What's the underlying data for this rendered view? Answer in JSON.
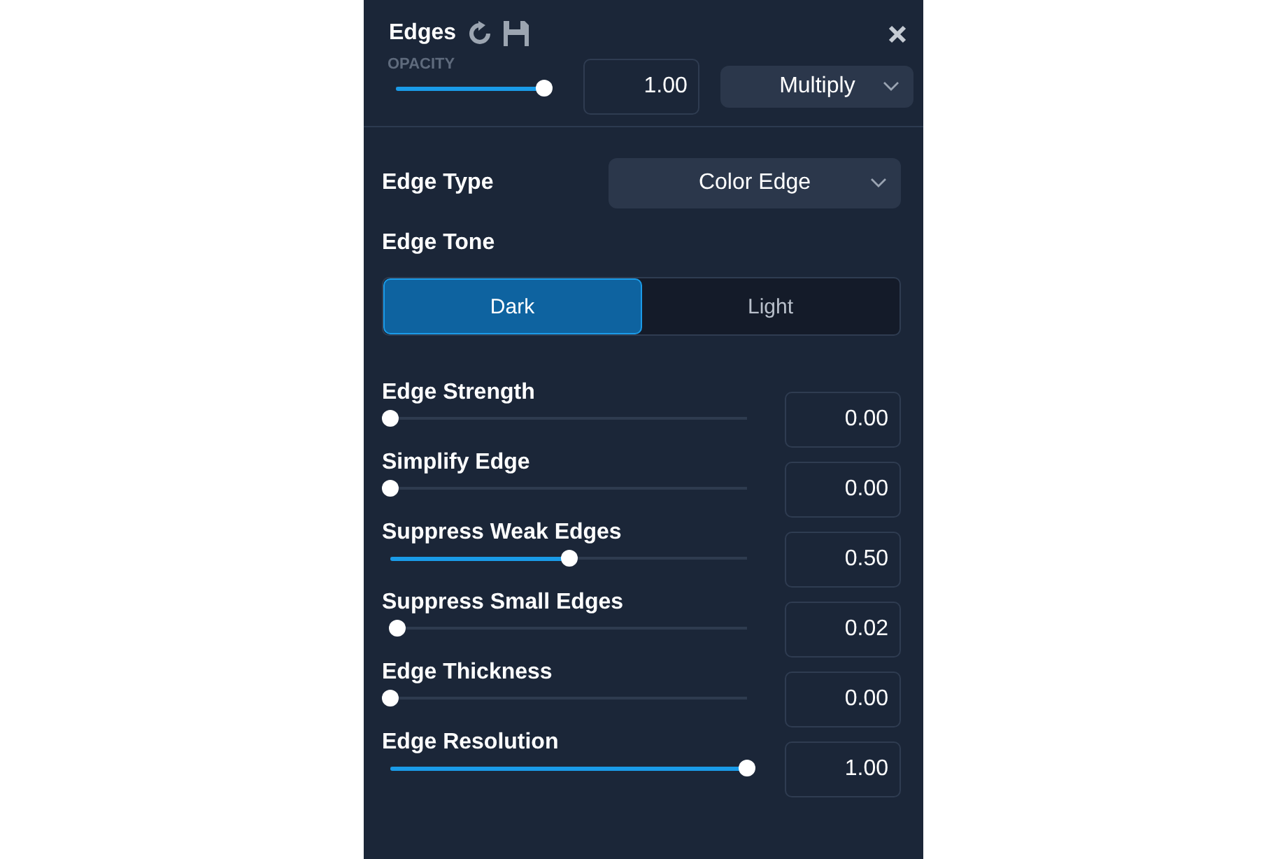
{
  "panel": {
    "title": "Edges"
  },
  "opacity": {
    "label": "OPACITY",
    "level": 1.0,
    "value": "1.00",
    "blend_mode": "Multiply"
  },
  "edge_type": {
    "label": "Edge Type",
    "value": "Color Edge"
  },
  "edge_tone": {
    "label": "Edge Tone",
    "options": [
      {
        "label": "Dark",
        "selected": true
      },
      {
        "label": "Light",
        "selected": false
      }
    ]
  },
  "sliders": [
    {
      "label": "Edge Strength",
      "level": 0.0,
      "value": "0.00"
    },
    {
      "label": "Simplify Edge",
      "level": 0.0,
      "value": "0.00"
    },
    {
      "label": "Suppress Weak Edges",
      "level": 0.5,
      "value": "0.50"
    },
    {
      "label": "Suppress Small Edges",
      "level": 0.02,
      "value": "0.02"
    },
    {
      "label": "Edge Thickness",
      "level": 0.0,
      "value": "0.00"
    },
    {
      "label": "Edge Resolution",
      "level": 1.0,
      "value": "1.00"
    }
  ]
}
